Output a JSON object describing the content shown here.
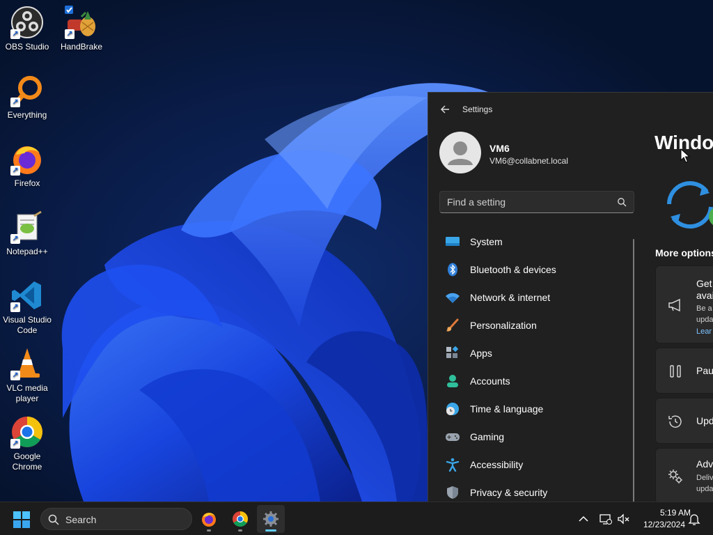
{
  "desktop": {
    "icons": [
      {
        "label": "OBS Studio",
        "icon": "obs-icon"
      },
      {
        "label": "HandBrake",
        "icon": "handbrake-icon"
      },
      {
        "label": "Everything",
        "icon": "everything-icon"
      },
      {
        "label": "Firefox",
        "icon": "firefox-icon"
      },
      {
        "label": "Notepad++",
        "icon": "notepadpp-icon"
      },
      {
        "label": "Visual Studio Code",
        "icon": "vscode-icon"
      },
      {
        "label": "VLC media player",
        "icon": "vlc-icon"
      },
      {
        "label": "Google Chrome",
        "icon": "chrome-icon"
      }
    ]
  },
  "settings": {
    "title": "Settings",
    "profile": {
      "name": "VM6",
      "email": "VM6@collabnet.local"
    },
    "search": {
      "placeholder": "Find a setting"
    },
    "nav": [
      {
        "label": "System",
        "icon": "system-icon"
      },
      {
        "label": "Bluetooth & devices",
        "icon": "bluetooth-icon"
      },
      {
        "label": "Network & internet",
        "icon": "wifi-icon"
      },
      {
        "label": "Personalization",
        "icon": "brush-icon"
      },
      {
        "label": "Apps",
        "icon": "apps-icon"
      },
      {
        "label": "Accounts",
        "icon": "accounts-icon"
      },
      {
        "label": "Time & language",
        "icon": "globe-clock-icon"
      },
      {
        "label": "Gaming",
        "icon": "gamepad-icon"
      },
      {
        "label": "Accessibility",
        "icon": "accessibility-icon"
      },
      {
        "label": "Privacy & security",
        "icon": "shield-icon"
      }
    ],
    "content": {
      "page_title": "Windo",
      "more_options": "More options",
      "cards": [
        {
          "title": "Get",
          "title2": "avai",
          "sub1": "Be a",
          "sub2": "upda",
          "link": "Lear",
          "icon": "megaphone-icon"
        },
        {
          "title": "Paus",
          "icon": "pause-icon"
        },
        {
          "title": "Upd",
          "icon": "history-icon"
        },
        {
          "title": "Adv",
          "sub1": "Deliv",
          "sub2": "upda",
          "icon": "gears-icon"
        }
      ]
    }
  },
  "taskbar": {
    "search_label": "Search",
    "apps": [
      "firefox-icon",
      "chrome-icon",
      "settings-gear-icon"
    ],
    "clock": {
      "time": "5:19 AM",
      "date": "12/23/2024"
    }
  },
  "colors": {
    "accent": "#60cdff",
    "window_bg": "#202020",
    "taskbar_bg": "#1c1c1c"
  }
}
